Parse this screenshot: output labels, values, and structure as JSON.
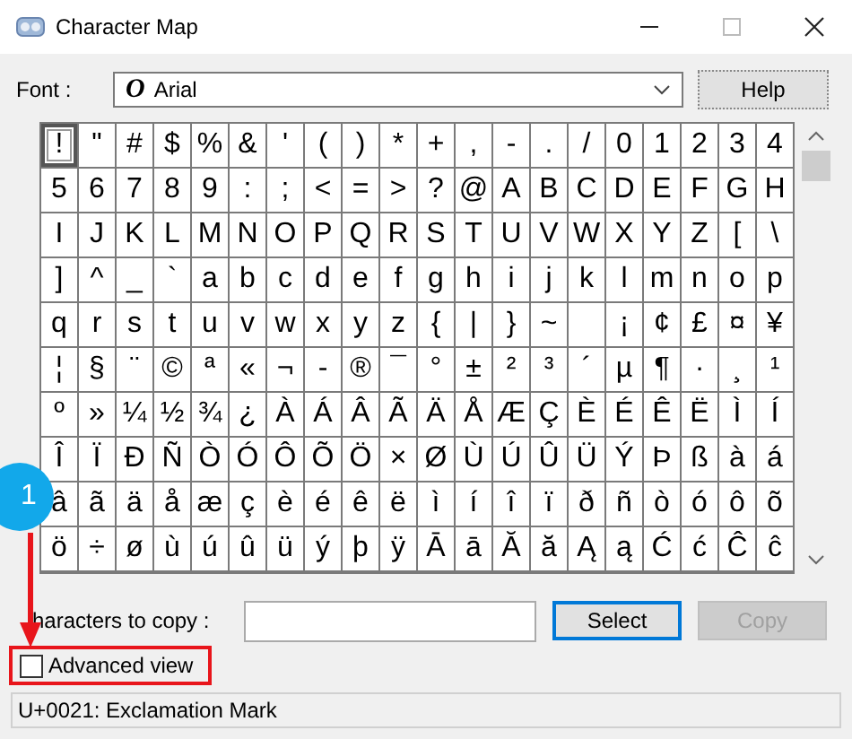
{
  "window": {
    "title": "Character Map"
  },
  "font": {
    "label": "Font :",
    "value": "Arial",
    "glyph": "O"
  },
  "help_button": "Help",
  "grid": [
    [
      {
        "char": "!",
        "selected": true
      },
      {
        "char": "\"",
        "selected": false
      },
      {
        "char": "#",
        "selected": false
      },
      {
        "char": "$",
        "selected": false
      },
      {
        "char": "%",
        "selected": false
      },
      {
        "char": "&",
        "selected": false
      },
      {
        "char": "'",
        "selected": false
      },
      {
        "char": "(",
        "selected": false
      },
      {
        "char": ")",
        "selected": false
      },
      {
        "char": "*",
        "selected": false
      },
      {
        "char": "+",
        "selected": false
      },
      {
        "char": ",",
        "selected": false
      },
      {
        "char": "-",
        "selected": false
      },
      {
        "char": ".",
        "selected": false
      },
      {
        "char": "/",
        "selected": false
      },
      {
        "char": "0",
        "selected": false
      },
      {
        "char": "1",
        "selected": false
      },
      {
        "char": "2",
        "selected": false
      },
      {
        "char": "3",
        "selected": false
      },
      {
        "char": "4",
        "selected": false
      }
    ],
    [
      {
        "char": "5",
        "selected": false
      },
      {
        "char": "6",
        "selected": false
      },
      {
        "char": "7",
        "selected": false
      },
      {
        "char": "8",
        "selected": false
      },
      {
        "char": "9",
        "selected": false
      },
      {
        "char": ":",
        "selected": false
      },
      {
        "char": ";",
        "selected": false
      },
      {
        "char": "<",
        "selected": false
      },
      {
        "char": "=",
        "selected": false
      },
      {
        "char": ">",
        "selected": false
      },
      {
        "char": "?",
        "selected": false
      },
      {
        "char": "@",
        "selected": false
      },
      {
        "char": "A",
        "selected": false
      },
      {
        "char": "B",
        "selected": false
      },
      {
        "char": "C",
        "selected": false
      },
      {
        "char": "D",
        "selected": false
      },
      {
        "char": "E",
        "selected": false
      },
      {
        "char": "F",
        "selected": false
      },
      {
        "char": "G",
        "selected": false
      },
      {
        "char": "H",
        "selected": false
      }
    ],
    [
      {
        "char": "I",
        "selected": false
      },
      {
        "char": "J",
        "selected": false
      },
      {
        "char": "K",
        "selected": false
      },
      {
        "char": "L",
        "selected": false
      },
      {
        "char": "M",
        "selected": false
      },
      {
        "char": "N",
        "selected": false
      },
      {
        "char": "O",
        "selected": false
      },
      {
        "char": "P",
        "selected": false
      },
      {
        "char": "Q",
        "selected": false
      },
      {
        "char": "R",
        "selected": false
      },
      {
        "char": "S",
        "selected": false
      },
      {
        "char": "T",
        "selected": false
      },
      {
        "char": "U",
        "selected": false
      },
      {
        "char": "V",
        "selected": false
      },
      {
        "char": "W",
        "selected": false
      },
      {
        "char": "X",
        "selected": false
      },
      {
        "char": "Y",
        "selected": false
      },
      {
        "char": "Z",
        "selected": false
      },
      {
        "char": "[",
        "selected": false
      },
      {
        "char": "\\",
        "selected": false
      }
    ],
    [
      {
        "char": "]",
        "selected": false
      },
      {
        "char": "^",
        "selected": false
      },
      {
        "char": "_",
        "selected": false
      },
      {
        "char": "`",
        "selected": false
      },
      {
        "char": "a",
        "selected": false
      },
      {
        "char": "b",
        "selected": false
      },
      {
        "char": "c",
        "selected": false
      },
      {
        "char": "d",
        "selected": false
      },
      {
        "char": "e",
        "selected": false
      },
      {
        "char": "f",
        "selected": false
      },
      {
        "char": "g",
        "selected": false
      },
      {
        "char": "h",
        "selected": false
      },
      {
        "char": "i",
        "selected": false
      },
      {
        "char": "j",
        "selected": false
      },
      {
        "char": "k",
        "selected": false
      },
      {
        "char": "l",
        "selected": false
      },
      {
        "char": "m",
        "selected": false
      },
      {
        "char": "n",
        "selected": false
      },
      {
        "char": "o",
        "selected": false
      },
      {
        "char": "p",
        "selected": false
      }
    ],
    [
      {
        "char": "q",
        "selected": false
      },
      {
        "char": "r",
        "selected": false
      },
      {
        "char": "s",
        "selected": false
      },
      {
        "char": "t",
        "selected": false
      },
      {
        "char": "u",
        "selected": false
      },
      {
        "char": "v",
        "selected": false
      },
      {
        "char": "w",
        "selected": false
      },
      {
        "char": "x",
        "selected": false
      },
      {
        "char": "y",
        "selected": false
      },
      {
        "char": "z",
        "selected": false
      },
      {
        "char": "{",
        "selected": false
      },
      {
        "char": "|",
        "selected": false
      },
      {
        "char": "}",
        "selected": false
      },
      {
        "char": "~",
        "selected": false
      },
      {
        "selected": false
      },
      {
        "char": "¡",
        "selected": false
      },
      {
        "char": "¢",
        "selected": false
      },
      {
        "char": "£",
        "selected": false
      },
      {
        "char": "¤",
        "selected": false
      },
      {
        "char": "¥",
        "selected": false
      }
    ],
    [
      {
        "char": "¦",
        "selected": false
      },
      {
        "char": "§",
        "selected": false
      },
      {
        "char": "¨",
        "selected": false
      },
      {
        "char": "©",
        "selected": false
      },
      {
        "char": "ª",
        "selected": false
      },
      {
        "char": "«",
        "selected": false
      },
      {
        "char": "¬",
        "selected": false
      },
      {
        "char": "-",
        "selected": false
      },
      {
        "char": "®",
        "selected": false
      },
      {
        "char": "¯",
        "selected": false
      },
      {
        "char": "°",
        "selected": false
      },
      {
        "char": "±",
        "selected": false
      },
      {
        "char": "²",
        "selected": false
      },
      {
        "char": "³",
        "selected": false
      },
      {
        "char": "´",
        "selected": false
      },
      {
        "char": "µ",
        "selected": false
      },
      {
        "char": "¶",
        "selected": false
      },
      {
        "char": "·",
        "selected": false
      },
      {
        "char": "¸",
        "selected": false
      },
      {
        "char": "¹",
        "selected": false
      }
    ],
    [
      {
        "char": "º",
        "selected": false
      },
      {
        "char": "»",
        "selected": false
      },
      {
        "char": "¼",
        "selected": false
      },
      {
        "char": "½",
        "selected": false
      },
      {
        "char": "¾",
        "selected": false
      },
      {
        "char": "¿",
        "selected": false
      },
      {
        "char": "À",
        "selected": false
      },
      {
        "char": "Á",
        "selected": false
      },
      {
        "char": "Â",
        "selected": false
      },
      {
        "char": "Ã",
        "selected": false
      },
      {
        "char": "Ä",
        "selected": false
      },
      {
        "char": "Å",
        "selected": false
      },
      {
        "char": "Æ",
        "selected": false
      },
      {
        "char": "Ç",
        "selected": false
      },
      {
        "char": "È",
        "selected": false
      },
      {
        "char": "É",
        "selected": false
      },
      {
        "char": "Ê",
        "selected": false
      },
      {
        "char": "Ë",
        "selected": false
      },
      {
        "char": "Ì",
        "selected": false
      },
      {
        "char": "Í",
        "selected": false
      }
    ],
    [
      {
        "char": "Î",
        "selected": false
      },
      {
        "char": "Ï",
        "selected": false
      },
      {
        "char": "Ð",
        "selected": false
      },
      {
        "char": "Ñ",
        "selected": false
      },
      {
        "char": "Ò",
        "selected": false
      },
      {
        "char": "Ó",
        "selected": false
      },
      {
        "char": "Ô",
        "selected": false
      },
      {
        "char": "Õ",
        "selected": false
      },
      {
        "char": "Ö",
        "selected": false
      },
      {
        "char": "×",
        "selected": false
      },
      {
        "char": "Ø",
        "selected": false
      },
      {
        "char": "Ù",
        "selected": false
      },
      {
        "char": "Ú",
        "selected": false
      },
      {
        "char": "Û",
        "selected": false
      },
      {
        "char": "Ü",
        "selected": false
      },
      {
        "char": "Ý",
        "selected": false
      },
      {
        "char": "Þ",
        "selected": false
      },
      {
        "char": "ß",
        "selected": false
      },
      {
        "char": "à",
        "selected": false
      },
      {
        "char": "á",
        "selected": false
      }
    ],
    [
      {
        "char": "â",
        "selected": false
      },
      {
        "char": "ã",
        "selected": false
      },
      {
        "char": "ä",
        "selected": false
      },
      {
        "char": "å",
        "selected": false
      },
      {
        "char": "æ",
        "selected": false
      },
      {
        "char": "ç",
        "selected": false
      },
      {
        "char": "è",
        "selected": false
      },
      {
        "char": "é",
        "selected": false
      },
      {
        "char": "ê",
        "selected": false
      },
      {
        "char": "ë",
        "selected": false
      },
      {
        "char": "ì",
        "selected": false
      },
      {
        "char": "í",
        "selected": false
      },
      {
        "char": "î",
        "selected": false
      },
      {
        "char": "ï",
        "selected": false
      },
      {
        "char": "ð",
        "selected": false
      },
      {
        "char": "ñ",
        "selected": false
      },
      {
        "char": "ò",
        "selected": false
      },
      {
        "char": "ó",
        "selected": false
      },
      {
        "char": "ô",
        "selected": false
      },
      {
        "char": "õ",
        "selected": false
      }
    ],
    [
      {
        "char": "ö",
        "selected": false
      },
      {
        "char": "÷",
        "selected": false
      },
      {
        "char": "ø",
        "selected": false
      },
      {
        "char": "ù",
        "selected": false
      },
      {
        "char": "ú",
        "selected": false
      },
      {
        "char": "û",
        "selected": false
      },
      {
        "char": "ü",
        "selected": false
      },
      {
        "char": "ý",
        "selected": false
      },
      {
        "char": "þ",
        "selected": false
      },
      {
        "char": "ÿ",
        "selected": false
      },
      {
        "char": "Ā",
        "selected": false
      },
      {
        "char": "ā",
        "selected": false
      },
      {
        "char": "Ă",
        "selected": false
      },
      {
        "char": "ă",
        "selected": false
      },
      {
        "char": "Ą",
        "selected": false
      },
      {
        "char": "ą",
        "selected": false
      },
      {
        "char": "Ć",
        "selected": false
      },
      {
        "char": "ć",
        "selected": false
      },
      {
        "char": "Ĉ",
        "selected": false
      },
      {
        "char": "ĉ",
        "selected": false
      }
    ]
  ],
  "copy": {
    "label": "haracters to copy :",
    "select_button": "Select",
    "copy_button": {
      "label": "Copy",
      "disabled": true
    }
  },
  "advanced_view": {
    "label": "Advanced view",
    "checked": false
  },
  "status_bar": "U+0021: Exclamation Mark",
  "annotation": {
    "step": "1"
  }
}
